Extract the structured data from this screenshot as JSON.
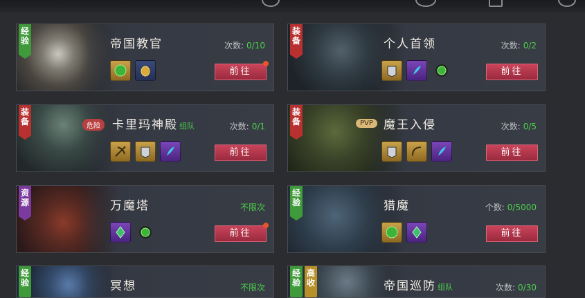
{
  "cards": [
    {
      "tag": "经验",
      "title": "帝国教官",
      "team": "",
      "count_label": "次数:",
      "count_value": "0/10",
      "button": "前往",
      "badge": "",
      "icons": [
        "armor-icon-green",
        "gold-coin-icon"
      ]
    },
    {
      "tag": "装备",
      "title": "个人首领",
      "team": "",
      "count_label": "次数:",
      "count_value": "0/2",
      "button": "前往",
      "badge": "",
      "icons": [
        "chest-armor-icon",
        "feather-icon",
        "exp-orb-icon"
      ]
    },
    {
      "tag": "装备",
      "title": "卡里玛神殿",
      "team": "组队",
      "count_label": "次数:",
      "count_value": "0/1",
      "button": "前往",
      "badge": "危险",
      "icons": [
        "crossbow-icon",
        "chest-armor-icon",
        "feather-icon"
      ]
    },
    {
      "tag": "装备",
      "title": "魔王入侵",
      "team": "",
      "count_label": "次数:",
      "count_value": "0/5",
      "button": "前往",
      "badge": "PVP",
      "icons": [
        "chest-armor-icon",
        "bow-icon",
        "feather-icon"
      ]
    },
    {
      "tag": "资源",
      "title": "万魔塔",
      "team": "",
      "count_label": "不限次",
      "count_value": "",
      "button": "前往",
      "badge": "",
      "icons": [
        "crystal-icon",
        "exp-orb-icon"
      ]
    },
    {
      "tag": "经验",
      "title": "猎魔",
      "team": "",
      "count_label": "个数:",
      "count_value": "0/5000",
      "button": "前往",
      "badge": "",
      "icons": [
        "exp-orb-icon",
        "crystal-icon"
      ]
    },
    {
      "tag": "经验",
      "title": "冥想",
      "team": "",
      "count_label": "不限次",
      "count_value": "",
      "button": "",
      "badge": ""
    },
    {
      "tag": "经验",
      "tag2": "高收",
      "title": "帝国巡防",
      "team": "组队",
      "count_label": "次数:",
      "count_value": "0/30",
      "button": "",
      "badge": ""
    }
  ],
  "colors": {
    "accent_green": "#4cd04a",
    "button_red": "#b83a4e",
    "notify": "#e8542a"
  }
}
